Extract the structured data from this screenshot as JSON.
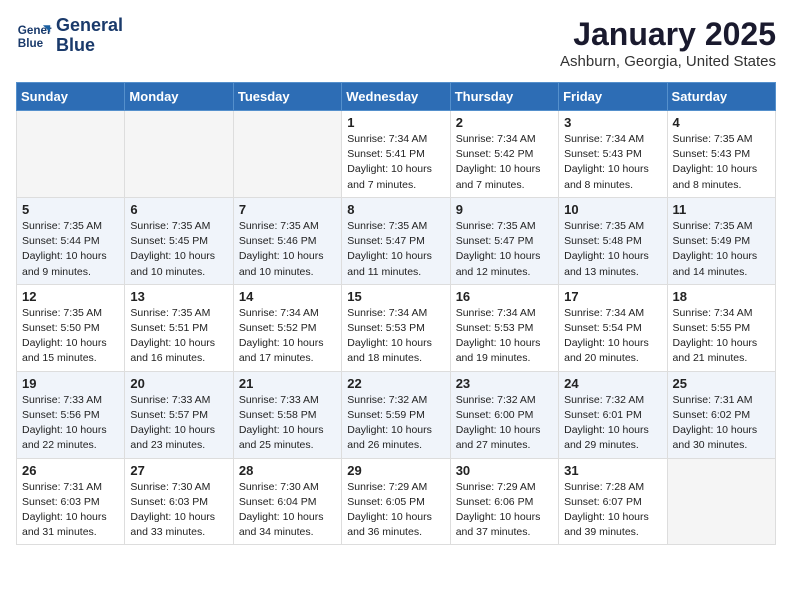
{
  "header": {
    "logo_line1": "General",
    "logo_line2": "Blue",
    "title": "January 2025",
    "subtitle": "Ashburn, Georgia, United States"
  },
  "weekdays": [
    "Sunday",
    "Monday",
    "Tuesday",
    "Wednesday",
    "Thursday",
    "Friday",
    "Saturday"
  ],
  "weeks": [
    [
      {
        "day": "",
        "empty": true
      },
      {
        "day": "",
        "empty": true
      },
      {
        "day": "",
        "empty": true
      },
      {
        "day": "1",
        "sunrise": "7:34 AM",
        "sunset": "5:41 PM",
        "daylight": "10 hours and 7 minutes."
      },
      {
        "day": "2",
        "sunrise": "7:34 AM",
        "sunset": "5:42 PM",
        "daylight": "10 hours and 7 minutes."
      },
      {
        "day": "3",
        "sunrise": "7:34 AM",
        "sunset": "5:43 PM",
        "daylight": "10 hours and 8 minutes."
      },
      {
        "day": "4",
        "sunrise": "7:35 AM",
        "sunset": "5:43 PM",
        "daylight": "10 hours and 8 minutes."
      }
    ],
    [
      {
        "day": "5",
        "sunrise": "7:35 AM",
        "sunset": "5:44 PM",
        "daylight": "10 hours and 9 minutes."
      },
      {
        "day": "6",
        "sunrise": "7:35 AM",
        "sunset": "5:45 PM",
        "daylight": "10 hours and 10 minutes."
      },
      {
        "day": "7",
        "sunrise": "7:35 AM",
        "sunset": "5:46 PM",
        "daylight": "10 hours and 10 minutes."
      },
      {
        "day": "8",
        "sunrise": "7:35 AM",
        "sunset": "5:47 PM",
        "daylight": "10 hours and 11 minutes."
      },
      {
        "day": "9",
        "sunrise": "7:35 AM",
        "sunset": "5:47 PM",
        "daylight": "10 hours and 12 minutes."
      },
      {
        "day": "10",
        "sunrise": "7:35 AM",
        "sunset": "5:48 PM",
        "daylight": "10 hours and 13 minutes."
      },
      {
        "day": "11",
        "sunrise": "7:35 AM",
        "sunset": "5:49 PM",
        "daylight": "10 hours and 14 minutes."
      }
    ],
    [
      {
        "day": "12",
        "sunrise": "7:35 AM",
        "sunset": "5:50 PM",
        "daylight": "10 hours and 15 minutes."
      },
      {
        "day": "13",
        "sunrise": "7:35 AM",
        "sunset": "5:51 PM",
        "daylight": "10 hours and 16 minutes."
      },
      {
        "day": "14",
        "sunrise": "7:34 AM",
        "sunset": "5:52 PM",
        "daylight": "10 hours and 17 minutes."
      },
      {
        "day": "15",
        "sunrise": "7:34 AM",
        "sunset": "5:53 PM",
        "daylight": "10 hours and 18 minutes."
      },
      {
        "day": "16",
        "sunrise": "7:34 AM",
        "sunset": "5:53 PM",
        "daylight": "10 hours and 19 minutes."
      },
      {
        "day": "17",
        "sunrise": "7:34 AM",
        "sunset": "5:54 PM",
        "daylight": "10 hours and 20 minutes."
      },
      {
        "day": "18",
        "sunrise": "7:34 AM",
        "sunset": "5:55 PM",
        "daylight": "10 hours and 21 minutes."
      }
    ],
    [
      {
        "day": "19",
        "sunrise": "7:33 AM",
        "sunset": "5:56 PM",
        "daylight": "10 hours and 22 minutes."
      },
      {
        "day": "20",
        "sunrise": "7:33 AM",
        "sunset": "5:57 PM",
        "daylight": "10 hours and 23 minutes."
      },
      {
        "day": "21",
        "sunrise": "7:33 AM",
        "sunset": "5:58 PM",
        "daylight": "10 hours and 25 minutes."
      },
      {
        "day": "22",
        "sunrise": "7:32 AM",
        "sunset": "5:59 PM",
        "daylight": "10 hours and 26 minutes."
      },
      {
        "day": "23",
        "sunrise": "7:32 AM",
        "sunset": "6:00 PM",
        "daylight": "10 hours and 27 minutes."
      },
      {
        "day": "24",
        "sunrise": "7:32 AM",
        "sunset": "6:01 PM",
        "daylight": "10 hours and 29 minutes."
      },
      {
        "day": "25",
        "sunrise": "7:31 AM",
        "sunset": "6:02 PM",
        "daylight": "10 hours and 30 minutes."
      }
    ],
    [
      {
        "day": "26",
        "sunrise": "7:31 AM",
        "sunset": "6:03 PM",
        "daylight": "10 hours and 31 minutes."
      },
      {
        "day": "27",
        "sunrise": "7:30 AM",
        "sunset": "6:03 PM",
        "daylight": "10 hours and 33 minutes."
      },
      {
        "day": "28",
        "sunrise": "7:30 AM",
        "sunset": "6:04 PM",
        "daylight": "10 hours and 34 minutes."
      },
      {
        "day": "29",
        "sunrise": "7:29 AM",
        "sunset": "6:05 PM",
        "daylight": "10 hours and 36 minutes."
      },
      {
        "day": "30",
        "sunrise": "7:29 AM",
        "sunset": "6:06 PM",
        "daylight": "10 hours and 37 minutes."
      },
      {
        "day": "31",
        "sunrise": "7:28 AM",
        "sunset": "6:07 PM",
        "daylight": "10 hours and 39 minutes."
      },
      {
        "day": "",
        "empty": true
      }
    ]
  ],
  "labels": {
    "sunrise": "Sunrise:",
    "sunset": "Sunset:",
    "daylight": "Daylight:"
  }
}
